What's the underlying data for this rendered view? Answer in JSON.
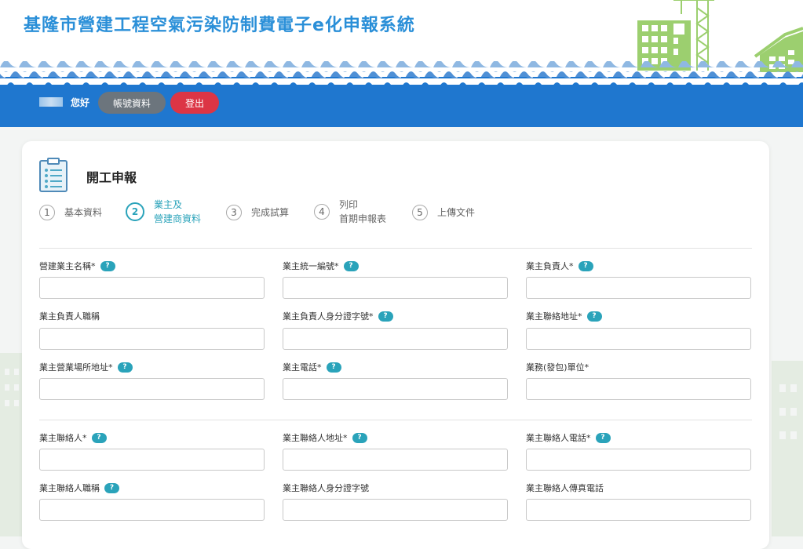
{
  "header": {
    "title": "基隆市營建工程空氣污染防制費電子e化申報系統",
    "greeting": "您好",
    "account_button": "帳號資料",
    "logout_button": "登出"
  },
  "page": {
    "title": "開工申報"
  },
  "steps": [
    {
      "num": "1",
      "label": "基本資料",
      "active": false
    },
    {
      "num": "2",
      "label": "業主及\n營建商資料",
      "active": true
    },
    {
      "num": "3",
      "label": "完成試算",
      "active": false
    },
    {
      "num": "4",
      "label": "列印\n首期申報表",
      "active": false
    },
    {
      "num": "5",
      "label": "上傳文件",
      "active": false
    }
  ],
  "form": {
    "fields": [
      {
        "label": "營建業主名稱*",
        "help": "?",
        "value": ""
      },
      {
        "label": "業主統一編號*",
        "help": "?",
        "value": ""
      },
      {
        "label": "業主負責人*",
        "help": "?",
        "value": ""
      },
      {
        "label": "業主負責人職稱",
        "help": "",
        "value": ""
      },
      {
        "label": "業主負責人身分證字號*",
        "help": "?",
        "value": ""
      },
      {
        "label": "業主聯絡地址*",
        "help": "?",
        "value": ""
      },
      {
        "label": "業主營業場所地址*",
        "help": "?",
        "value": ""
      },
      {
        "label": "業主電話*",
        "help": "?",
        "value": ""
      },
      {
        "label": "業務(發包)單位*",
        "help": "",
        "value": ""
      },
      {
        "label": "業主聯絡人*",
        "help": "?",
        "value": ""
      },
      {
        "label": "業主聯絡人地址*",
        "help": "?",
        "value": ""
      },
      {
        "label": "業主聯絡人電話*",
        "help": "?",
        "value": ""
      },
      {
        "label": "業主聯絡人職稱",
        "help": "?",
        "value": ""
      },
      {
        "label": "業主聯絡人身分證字號",
        "help": "",
        "value": ""
      },
      {
        "label": "業主聯絡人傳真電話",
        "help": "",
        "value": ""
      }
    ]
  },
  "colors": {
    "brand_blue": "#1f77cf",
    "title_blue": "#2a8fd8",
    "accent_teal": "#2aa3ba",
    "logout_red": "#dc3545",
    "account_gray": "#6c757d",
    "building_green": "#9ccf6f"
  },
  "icons": {
    "page": "clipboard-icon",
    "help": "help-icon"
  }
}
